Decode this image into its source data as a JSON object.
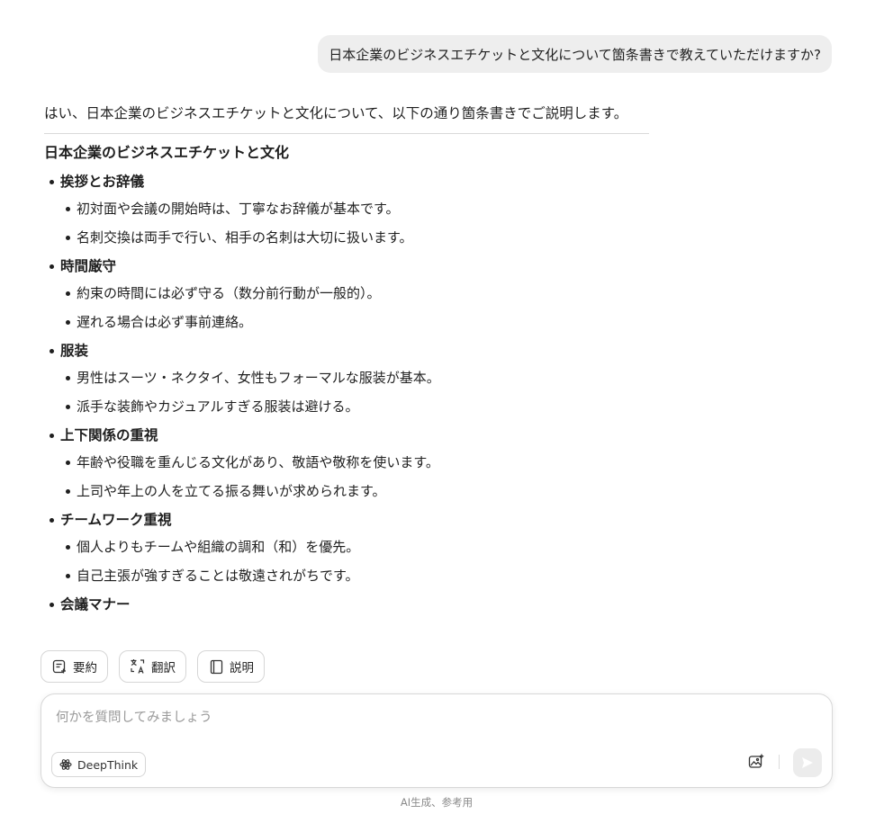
{
  "user_message": "日本企業のビジネスエチケットと文化について箇条書きで教えていただけますか?",
  "answer": {
    "intro": "はい、日本企業のビジネスエチケットと文化について、以下の通り箇条書きでご説明します。",
    "title": "日本企業のビジネスエチケットと文化",
    "sections": [
      {
        "heading": "挨拶とお辞儀",
        "bullets": [
          "初対面や会議の開始時は、丁寧なお辞儀が基本です。",
          "名刺交換は両手で行い、相手の名刺は大切に扱います。"
        ]
      },
      {
        "heading": "時間厳守",
        "bullets": [
          "約束の時間には必ず守る（数分前行動が一般的）。",
          "遅れる場合は必ず事前連絡。"
        ]
      },
      {
        "heading": "服装",
        "bullets": [
          "男性はスーツ・ネクタイ、女性もフォーマルな服装が基本。",
          "派手な装飾やカジュアルすぎる服装は避ける。"
        ]
      },
      {
        "heading": "上下関係の重視",
        "bullets": [
          "年齢や役職を重んじる文化があり、敬語や敬称を使います。",
          "上司や年上の人を立てる振る舞いが求められます。"
        ]
      },
      {
        "heading": "チームワーク重視",
        "bullets": [
          "個人よりもチームや組織の調和（和）を優先。",
          "自己主張が強すぎることは敬遠されがちです。"
        ]
      },
      {
        "heading": "会議マナー",
        "bullets": []
      }
    ]
  },
  "quick_actions": [
    {
      "label": "要約",
      "icon": "summary-icon"
    },
    {
      "label": "翻訳",
      "icon": "translate-icon"
    },
    {
      "label": "説明",
      "icon": "book-icon"
    }
  ],
  "composer": {
    "placeholder": "何かを質問してみましょう",
    "value": "",
    "deepthink_label": "DeepThink",
    "deepthink_icon": "atom-icon",
    "image_icon": "image-upload-icon",
    "send_icon": "send-icon"
  },
  "footer_note": "AI生成、参考用"
}
